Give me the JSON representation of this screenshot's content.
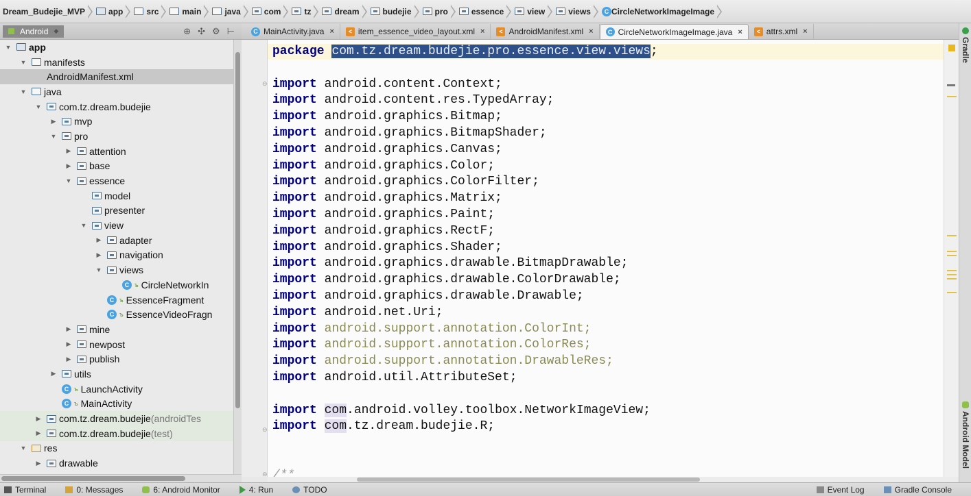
{
  "breadcrumbs": [
    {
      "label": "Dream_Budejie_MVP",
      "icon": "project-icon"
    },
    {
      "label": "app",
      "icon": "module-folder-icon"
    },
    {
      "label": "src",
      "icon": "folder-icon"
    },
    {
      "label": "main",
      "icon": "folder-icon"
    },
    {
      "label": "java",
      "icon": "folder-icon"
    },
    {
      "label": "com",
      "icon": "package-icon"
    },
    {
      "label": "tz",
      "icon": "package-icon"
    },
    {
      "label": "dream",
      "icon": "package-icon"
    },
    {
      "label": "budejie",
      "icon": "package-icon"
    },
    {
      "label": "pro",
      "icon": "package-icon"
    },
    {
      "label": "essence",
      "icon": "package-icon"
    },
    {
      "label": "view",
      "icon": "package-icon"
    },
    {
      "label": "views",
      "icon": "package-icon"
    },
    {
      "label": "CircleNetworkImageImage",
      "icon": "class-icon"
    }
  ],
  "project_panel": {
    "view_mode": "Android",
    "tree": [
      {
        "label": "app",
        "depth": 0,
        "arrow": "down",
        "icon": "module-folder-icon",
        "bold": true
      },
      {
        "label": "manifests",
        "depth": 1,
        "arrow": "down",
        "icon": "folder-icon"
      },
      {
        "label": "AndroidManifest.xml",
        "depth": 2,
        "arrow": "",
        "icon": "",
        "selected": true
      },
      {
        "label": "java",
        "depth": 1,
        "arrow": "down",
        "icon": "folder-icon"
      },
      {
        "label": "com.tz.dream.budejie",
        "depth": 2,
        "arrow": "down",
        "icon": "package-icon"
      },
      {
        "label": "mvp",
        "depth": 3,
        "arrow": "right",
        "icon": "package-icon"
      },
      {
        "label": "pro",
        "depth": 3,
        "arrow": "down",
        "icon": "package-icon"
      },
      {
        "label": "attention",
        "depth": 4,
        "arrow": "right",
        "icon": "package-icon"
      },
      {
        "label": "base",
        "depth": 4,
        "arrow": "right",
        "icon": "package-icon"
      },
      {
        "label": "essence",
        "depth": 4,
        "arrow": "down",
        "icon": "package-icon"
      },
      {
        "label": "model",
        "depth": 5,
        "arrow": "",
        "icon": "package-icon"
      },
      {
        "label": "presenter",
        "depth": 5,
        "arrow": "",
        "icon": "package-icon"
      },
      {
        "label": "view",
        "depth": 5,
        "arrow": "down",
        "icon": "package-icon"
      },
      {
        "label": "adapter",
        "depth": 6,
        "arrow": "right",
        "icon": "package-icon"
      },
      {
        "label": "navigation",
        "depth": 6,
        "arrow": "right",
        "icon": "package-icon"
      },
      {
        "label": "views",
        "depth": 6,
        "arrow": "down",
        "icon": "package-icon"
      },
      {
        "label": "CircleNetworkIn",
        "depth": 7,
        "arrow": "",
        "icon": "class-icon"
      },
      {
        "label": "EssenceFragment",
        "depth": 6,
        "arrow": "",
        "icon": "class-icon"
      },
      {
        "label": "EssenceVideoFragn",
        "depth": 6,
        "arrow": "",
        "icon": "class-icon"
      },
      {
        "label": "mine",
        "depth": 4,
        "arrow": "right",
        "icon": "package-icon"
      },
      {
        "label": "newpost",
        "depth": 4,
        "arrow": "right",
        "icon": "package-icon"
      },
      {
        "label": "publish",
        "depth": 4,
        "arrow": "right",
        "icon": "package-icon"
      },
      {
        "label": "utils",
        "depth": 3,
        "arrow": "right",
        "icon": "package-icon"
      },
      {
        "label": "LaunchActivity",
        "depth": 3,
        "arrow": "",
        "icon": "class-icon"
      },
      {
        "label": "MainActivity",
        "depth": 3,
        "arrow": "",
        "icon": "class-icon"
      },
      {
        "label": "com.tz.dream.budejie",
        "suffix": " (androidTes",
        "depth": 2,
        "arrow": "right",
        "icon": "package-icon",
        "test": true
      },
      {
        "label": "com.tz.dream.budejie",
        "suffix": " (test)",
        "depth": 2,
        "arrow": "right",
        "icon": "package-icon",
        "test": true
      },
      {
        "label": "res",
        "depth": 1,
        "arrow": "down",
        "icon": "res-folder-icon"
      },
      {
        "label": "drawable",
        "depth": 2,
        "arrow": "right",
        "icon": "package-icon"
      }
    ]
  },
  "tabs": [
    {
      "label": "MainActivity.java",
      "icon": "class-icon",
      "active": false
    },
    {
      "label": "item_essence_video_layout.xml",
      "icon": "xml-icon",
      "active": false
    },
    {
      "label": "AndroidManifest.xml",
      "icon": "xml-icon",
      "active": false
    },
    {
      "label": "CircleNetworkImageImage.java",
      "icon": "class-icon",
      "active": true
    },
    {
      "label": "attrs.xml",
      "icon": "xml-icon",
      "active": false
    }
  ],
  "tab_close_glyph": "×",
  "code_lines": [
    {
      "segments": [
        {
          "t": "package",
          "c": "kw"
        },
        {
          "t": " "
        },
        {
          "t": "com.tz.dream.budejie.pro.essence.view.views",
          "c": "sel-text"
        },
        {
          "t": ";"
        }
      ]
    },
    {
      "segments": []
    },
    {
      "segments": [
        {
          "t": "import",
          "c": "kw"
        },
        {
          "t": " android.content.Context;"
        }
      ]
    },
    {
      "segments": [
        {
          "t": "import",
          "c": "kw"
        },
        {
          "t": " android.content.res.TypedArray;"
        }
      ]
    },
    {
      "segments": [
        {
          "t": "import",
          "c": "kw"
        },
        {
          "t": " android.graphics.Bitmap;"
        }
      ]
    },
    {
      "segments": [
        {
          "t": "import",
          "c": "kw"
        },
        {
          "t": " android.graphics.BitmapShader;"
        }
      ]
    },
    {
      "segments": [
        {
          "t": "import",
          "c": "kw"
        },
        {
          "t": " android.graphics.Canvas;"
        }
      ]
    },
    {
      "segments": [
        {
          "t": "import",
          "c": "kw"
        },
        {
          "t": " android.graphics.Color;"
        }
      ]
    },
    {
      "segments": [
        {
          "t": "import",
          "c": "kw"
        },
        {
          "t": " android.graphics.ColorFilter;"
        }
      ]
    },
    {
      "segments": [
        {
          "t": "import",
          "c": "kw"
        },
        {
          "t": " android.graphics.Matrix;"
        }
      ]
    },
    {
      "segments": [
        {
          "t": "import",
          "c": "kw"
        },
        {
          "t": " android.graphics.Paint;"
        }
      ]
    },
    {
      "segments": [
        {
          "t": "import",
          "c": "kw"
        },
        {
          "t": " android.graphics.RectF;"
        }
      ]
    },
    {
      "segments": [
        {
          "t": "import",
          "c": "kw"
        },
        {
          "t": " android.graphics.Shader;"
        }
      ]
    },
    {
      "segments": [
        {
          "t": "import",
          "c": "kw"
        },
        {
          "t": " android.graphics.drawable.BitmapDrawable;"
        }
      ]
    },
    {
      "segments": [
        {
          "t": "import",
          "c": "kw"
        },
        {
          "t": " android.graphics.drawable.ColorDrawable;"
        }
      ]
    },
    {
      "segments": [
        {
          "t": "import",
          "c": "kw"
        },
        {
          "t": " android.graphics.drawable.Drawable;"
        }
      ]
    },
    {
      "segments": [
        {
          "t": "import",
          "c": "kw"
        },
        {
          "t": " android.net.Uri;"
        }
      ]
    },
    {
      "segments": [
        {
          "t": "import",
          "c": "kw"
        },
        {
          "t": " "
        },
        {
          "t": "android.support.annotation.ColorInt;",
          "c": "unused"
        }
      ]
    },
    {
      "segments": [
        {
          "t": "import",
          "c": "kw"
        },
        {
          "t": " "
        },
        {
          "t": "android.support.annotation.ColorRes;",
          "c": "unused"
        }
      ]
    },
    {
      "segments": [
        {
          "t": "import",
          "c": "kw"
        },
        {
          "t": " "
        },
        {
          "t": "android.support.annotation.DrawableRes;",
          "c": "unused"
        }
      ]
    },
    {
      "segments": [
        {
          "t": "import",
          "c": "kw"
        },
        {
          "t": " android.util.AttributeSet;"
        }
      ]
    },
    {
      "segments": []
    },
    {
      "segments": [
        {
          "t": "import",
          "c": "kw"
        },
        {
          "t": " "
        },
        {
          "t": "com",
          "c": "hl"
        },
        {
          "t": ".android.volley.toolbox.NetworkImageView;"
        }
      ]
    },
    {
      "segments": [
        {
          "t": "import",
          "c": "kw"
        },
        {
          "t": " "
        },
        {
          "t": "com",
          "c": "hl"
        },
        {
          "t": ".tz.dream.budejie.R;"
        }
      ]
    },
    {
      "segments": []
    },
    {
      "segments": []
    },
    {
      "segments": [
        {
          "t": "/**",
          "c": "cmt"
        }
      ]
    }
  ],
  "right_tools": [
    "Gradle",
    "Android Model"
  ],
  "bottom_left_tools": [
    {
      "label": "Terminal",
      "icon": "terminal-icon"
    },
    {
      "label": "0: Messages",
      "icon": "messages-icon"
    },
    {
      "label": "6: Android Monitor",
      "icon": "android-monitor-icon"
    },
    {
      "label": "4: Run",
      "icon": "run-icon"
    },
    {
      "label": "TODO",
      "icon": "todo-icon"
    }
  ],
  "bottom_right_tools": [
    {
      "label": "Event Log",
      "icon": "event-log-icon"
    },
    {
      "label": "Gradle Console",
      "icon": "gradle-console-icon"
    }
  ],
  "colors": {
    "keyword": "#000080",
    "unused_import": "#8a8a55",
    "selection": "#2d4f8a",
    "current_line": "#fbf6dc"
  }
}
